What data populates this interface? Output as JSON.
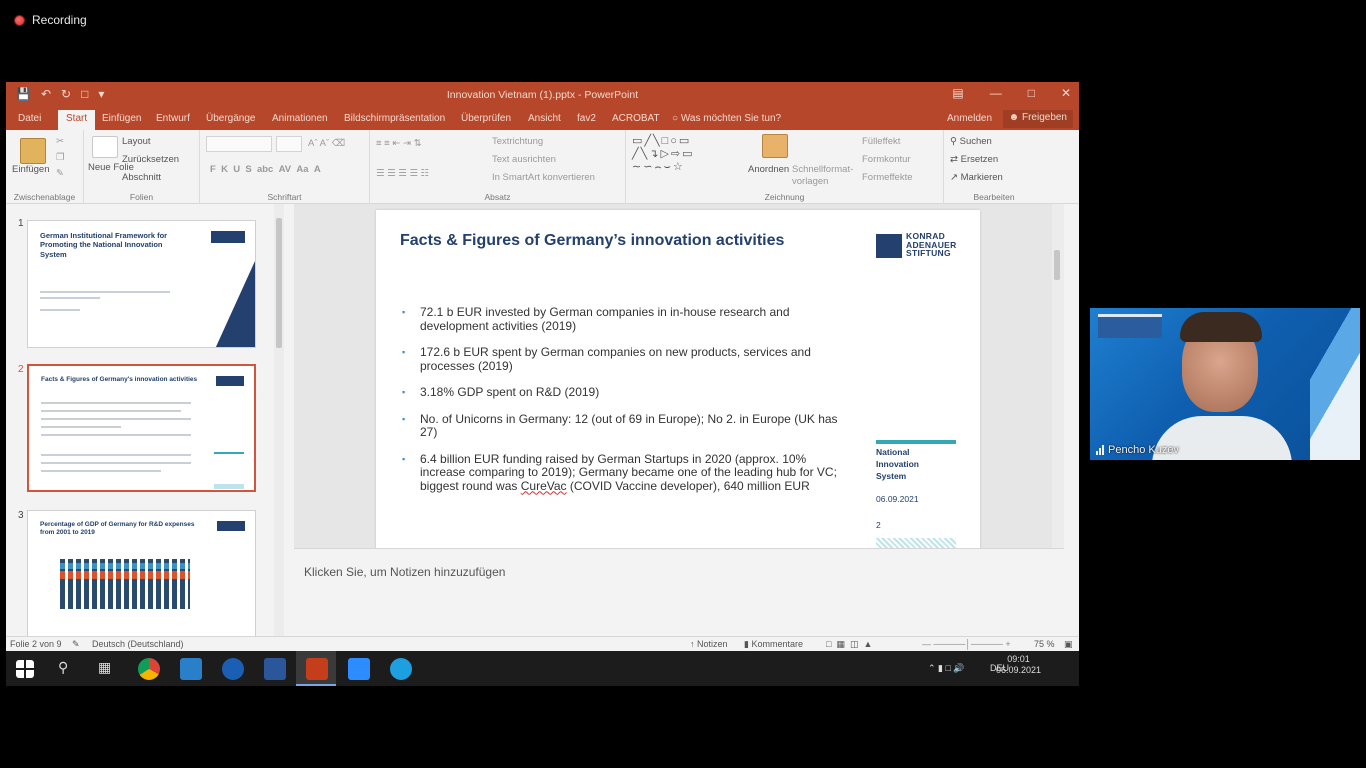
{
  "recording": {
    "label": "Recording"
  },
  "window": {
    "title": "Innovation Vietnam (1).pptx - PowerPoint"
  },
  "tabs": [
    "Datei",
    "Start",
    "Einfügen",
    "Entwurf",
    "Übergänge",
    "Animationen",
    "Bildschirmpräsentation",
    "Überprüfen",
    "Ansicht",
    "fav2",
    "ACROBAT"
  ],
  "tell_me": "Was möchten Sie tun?",
  "account": {
    "signin": "Anmelden",
    "share": "Freigeben"
  },
  "ribbon": {
    "clipboard": {
      "label": "Zwischenablage",
      "paste": "Einfügen"
    },
    "slides": {
      "label": "Folien",
      "new_slide": "Neue Folie",
      "layout": "Layout",
      "reset": "Zurücksetzen",
      "section": "Abschnitt"
    },
    "font": {
      "label": "Schriftart"
    },
    "paragraph": {
      "label": "Absatz",
      "text_direction": "Textrichtung",
      "align_text": "Text ausrichten",
      "smartart": "In SmartArt konvertieren"
    },
    "drawing": {
      "label": "Zeichnung",
      "arrange": "Anordnen",
      "quick_styles": "Schnellformat-vorlagen",
      "fill": "Fülleffekt",
      "outline": "Formkontur",
      "effects": "Formeffekte"
    },
    "editing": {
      "label": "Bearbeiten",
      "find": "Suchen",
      "replace": "Ersetzen",
      "select": "Markieren"
    }
  },
  "thumbnails": [
    {
      "num": "1",
      "title": "German Institutional Framework for Promoting the National Innovation System"
    },
    {
      "num": "2",
      "title": "Facts & Figures of Germany's innovation activities"
    },
    {
      "num": "3",
      "title": "Percentage of GDP of Germany for R&D expenses from 2001 to 2019"
    }
  ],
  "slide": {
    "title": "Facts & Figures of Germany’s innovation activities",
    "logo_lines": [
      "KONRAD",
      "ADENAUER",
      "STIFTUNG"
    ],
    "bullets": [
      "72.1 b EUR invested by German companies in in-house research and development activities (2019)",
      "172.6 b EUR spent by German companies on new products, services and processes (2019)",
      "3.18% GDP spent on R&D (2019)",
      "No. of Unicorns in Germany: 12 (out of 69 in Europe); No 2. in Europe (UK has 27)"
    ],
    "last_bullet": {
      "before": "6.4 billion EUR funding raised by German Startups in 2020 (approx. 10% increase comparing to 2019); Germany became one of the leading hub for VC; biggest round was ",
      "flagged": "CureVac",
      "after": " (COVID Vaccine developer), 640 million EUR"
    },
    "side_title_lines": [
      "National",
      "Innovation",
      "System"
    ],
    "side_date": "06.09.2021",
    "side_page": "2"
  },
  "notes": {
    "placeholder": "Klicken Sie, um Notizen hinzuzufügen"
  },
  "status": {
    "slide_count": "Folie 2 von 9",
    "language": "Deutsch (Deutschland)",
    "notes_btn": "Notizen",
    "comments_btn": "Kommentare",
    "zoom": "75 %"
  },
  "taskbar": {
    "lang": "DEU",
    "time": "09:01",
    "date": "06.09.2021"
  },
  "video": {
    "name": "Pencho Kuzev"
  }
}
